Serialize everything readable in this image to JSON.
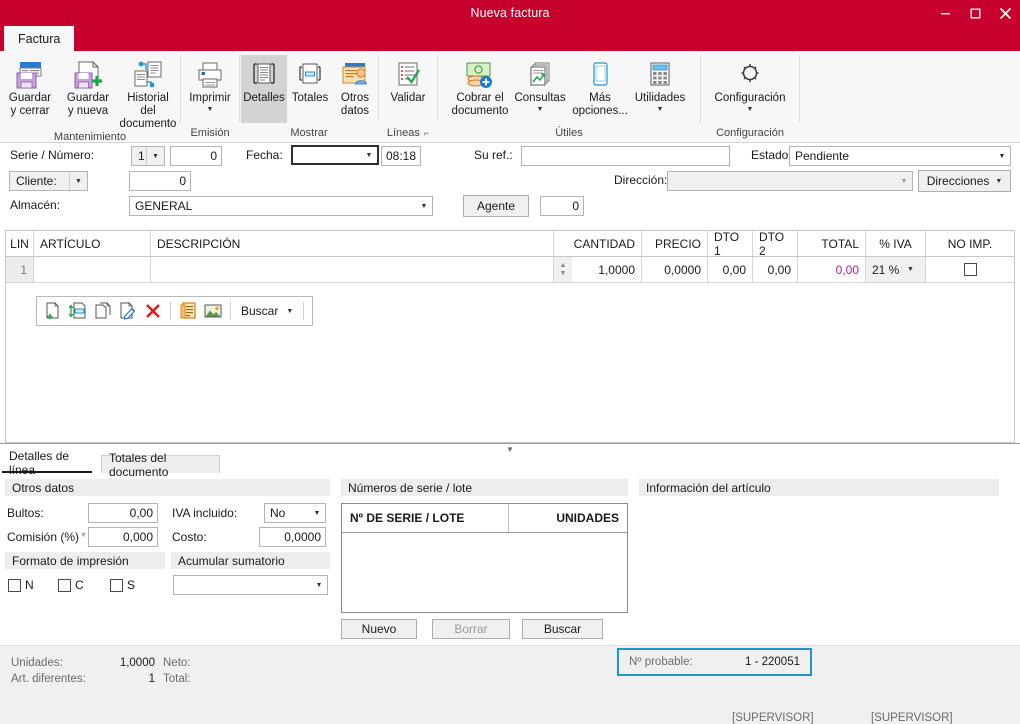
{
  "window": {
    "title": "Nueva factura",
    "minimize": "minimize-icon",
    "maximize": "maximize-icon",
    "close": "close-icon"
  },
  "ribbon": {
    "tab": "Factura",
    "groups": [
      {
        "label": "Mantenimiento",
        "buttons": [
          {
            "label": "Guardar\ny cerrar",
            "icon": "save-close-icon",
            "caret": false,
            "selected": false
          },
          {
            "label": "Guardar\ny nueva",
            "icon": "save-new-icon",
            "caret": true,
            "selected": false
          },
          {
            "label": "Historial del\ndocumento",
            "icon": "document-history-icon",
            "caret": false,
            "selected": false
          }
        ]
      },
      {
        "label": "Emisión",
        "buttons": [
          {
            "label": "Imprimir",
            "icon": "print-icon",
            "caret": true,
            "selected": false
          }
        ]
      },
      {
        "label": "Mostrar",
        "buttons": [
          {
            "label": "Detalles",
            "icon": "details-icon",
            "caret": false,
            "selected": true
          },
          {
            "label": "Totales",
            "icon": "totals-icon",
            "caret": false,
            "selected": false
          },
          {
            "label": "Otros\ndatos",
            "icon": "other-data-icon",
            "caret": false,
            "selected": false
          }
        ]
      },
      {
        "label": "Líneas",
        "launcher": "dialog-launcher-icon",
        "buttons": [
          {
            "label": "Validar",
            "icon": "validate-icon",
            "caret": false,
            "selected": false
          }
        ]
      },
      {
        "label": "Útiles",
        "buttons": [
          {
            "label": "Cobrar el\ndocumento",
            "icon": "collect-money-icon",
            "caret": false,
            "selected": false
          },
          {
            "label": "Consultas",
            "icon": "queries-icon",
            "caret": true,
            "selected": false
          },
          {
            "label": "Más\nopciones...",
            "icon": "more-options-icon",
            "caret": true,
            "selected": false
          },
          {
            "label": "Utilidades",
            "icon": "utilities-icon",
            "caret": true,
            "selected": false
          }
        ]
      },
      {
        "label": "Configuración",
        "buttons": [
          {
            "label": "Configuración",
            "icon": "gear-icon",
            "caret": true,
            "selected": false
          }
        ]
      }
    ]
  },
  "form": {
    "serie_numero_label": "Serie / Número:",
    "serie_value": "1",
    "numero_value": "0",
    "fecha_label": "Fecha:",
    "fecha_value": "",
    "hora_value": "08:18",
    "su_ref_label": "Su ref.:",
    "su_ref_value": "",
    "estado_label": "Estado:",
    "estado_value": "Pendiente",
    "cliente_label": "Cliente:",
    "cliente_value": "0",
    "direccion_label": "Dirección:",
    "direccion_value": "",
    "direcciones_button": "Direcciones",
    "almacen_label": "Almacén:",
    "almacen_value": "GENERAL",
    "agente_button": "Agente",
    "agente_value": "0"
  },
  "lines_grid": {
    "headers": [
      "LIN",
      "ARTÍCULO",
      "DESCRIPCIÓN",
      "",
      "CANTIDAD",
      "PRECIO",
      "DTO 1",
      "DTO 2",
      "TOTAL",
      "% IVA",
      "NO IMP."
    ],
    "rows": [
      {
        "lin": "1",
        "articulo": "",
        "descripcion": "",
        "cantidad": "1,0000",
        "precio": "0,0000",
        "dto1": "0,00",
        "dto2": "0,00",
        "total": "0,00",
        "iva": "21 %",
        "no_imp": false
      }
    ]
  },
  "line_toolbar": {
    "icons": [
      "new-line-icon",
      "insert-line-icon",
      "copy-line-icon",
      "edit-line-icon",
      "delete-line-icon",
      "notes-icon",
      "image-icon"
    ],
    "search_label": "Buscar"
  },
  "collapse": {
    "icon": "chevron-down-icon"
  },
  "bottom_tabs": [
    {
      "label": "Detalles de línea",
      "active": true
    },
    {
      "label": "Totales del documento",
      "active": false
    }
  ],
  "otros_datos": {
    "header": "Otros datos",
    "bultos_label": "Bultos:",
    "bultos_value": "0,00",
    "iva_incluido_label": "IVA incluido:",
    "iva_incluido_value": "No",
    "comision_label": "Comisión (%)",
    "comision_value": "0,000",
    "costo_label": "Costo:",
    "costo_value": "0,0000",
    "formato_header": "Formato de impresión",
    "formato_options": [
      "N",
      "C",
      "S"
    ],
    "acumular_header": "Acumular sumatorio",
    "acumular_value": ""
  },
  "serie_lote": {
    "header": "Números de serie / lote",
    "columns": [
      "Nº DE SERIE / LOTE",
      "UNIDADES"
    ],
    "rows": [],
    "buttons": [
      {
        "label": "Nuevo",
        "disabled": false
      },
      {
        "label": "Borrar",
        "disabled": true
      },
      {
        "label": "Buscar",
        "disabled": false
      }
    ]
  },
  "info_articulo": {
    "header": "Información del artículo"
  },
  "status": {
    "unidades_label": "Unidades:",
    "unidades_value": "1,0000",
    "neto_label": "Neto:",
    "neto_value": "",
    "art_diferentes_label": "Art. diferentes:",
    "art_diferentes_value": "1",
    "total_label": "Total:",
    "total_value": "",
    "probable_label": "Nº probable:",
    "probable_value": "1 - 220051",
    "user_left": "[SUPERVISOR]",
    "user_right": "[SUPERVISOR]"
  },
  "colors": {
    "brand_red": "#c8002e",
    "accent_blue": "#2196c9",
    "total_magenta": "#b0218a"
  }
}
